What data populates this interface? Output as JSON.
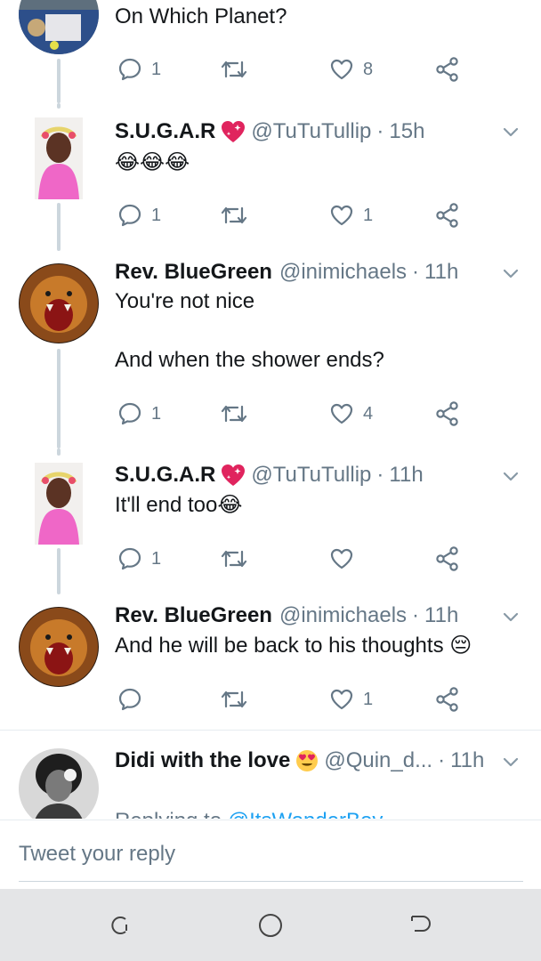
{
  "tweets": [
    {
      "text": "On Which Planet?",
      "replies": "1",
      "retweets": "",
      "likes": "8"
    },
    {
      "name": "S.U.G.A.R",
      "handle": "@TuTuTullip",
      "time": "15h",
      "text": "😂😂😂",
      "replies": "1",
      "retweets": "",
      "likes": "1"
    },
    {
      "name": "Rev. BlueGreen",
      "handle": "@inimichaels",
      "time": "11h",
      "text": "You're not nice\n\nAnd when the shower ends?",
      "replies": "1",
      "retweets": "",
      "likes": "4"
    },
    {
      "name": "S.U.G.A.R",
      "handle": "@TuTuTullip",
      "time": "11h",
      "text": "It'll end too😂",
      "replies": "1",
      "retweets": "",
      "likes": ""
    },
    {
      "name": "Rev. BlueGreen",
      "handle": "@inimichaels",
      "time": "11h",
      "text": "And he will be back to his thoughts 😔",
      "replies": "",
      "retweets": "",
      "likes": "1"
    },
    {
      "name": "Didi with the love",
      "handle": "@Quin_d...",
      "time": "11h",
      "replying_prefix": "Replying to ",
      "replying_to": "@ItsWonderBoy"
    }
  ],
  "compose": {
    "placeholder": "Tweet your reply"
  },
  "icons": {
    "reply": "reply-icon",
    "retweet": "retweet-icon",
    "like": "heart-icon",
    "share": "share-icon",
    "caret": "chevron-down-icon",
    "recents": "recent-apps-icon",
    "home": "home-icon",
    "back": "back-icon"
  },
  "colors": {
    "accent": "#1da1f2",
    "icon": "#657786",
    "thread_line": "#ccd6dd",
    "nav_bg": "#e4e5e7"
  }
}
